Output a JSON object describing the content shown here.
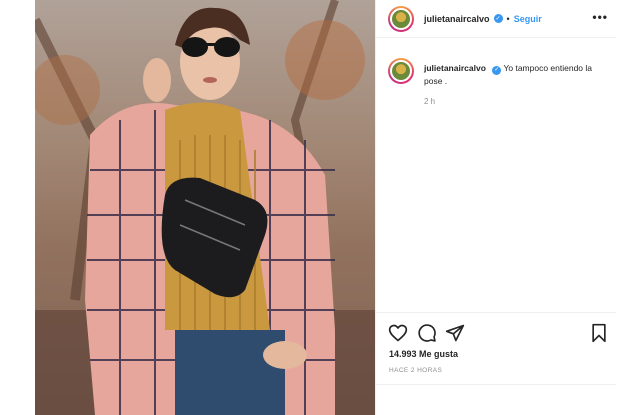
{
  "post": {
    "username": "julietanaircalvo",
    "separator": "•",
    "follow_label": "Seguir",
    "more_label": "•••",
    "caption_user": "julietanaircalvo",
    "caption_text": " Yo tampoco entiendo la pose .",
    "caption_time": "2 h",
    "likes": "14.993 Me gusta",
    "posted_ago": "HACE 2 HORAS"
  },
  "icons": {
    "verified": "verified-badge-icon",
    "like": "heart-icon",
    "comment": "comment-bubble-icon",
    "share": "paper-plane-icon",
    "save": "bookmark-icon"
  },
  "colors": {
    "link_blue": "#3897f0",
    "muted": "#8e8e8e",
    "text": "#262626",
    "coat_pink": "#e8a9a1",
    "sweater_mustard": "#c9983f"
  }
}
